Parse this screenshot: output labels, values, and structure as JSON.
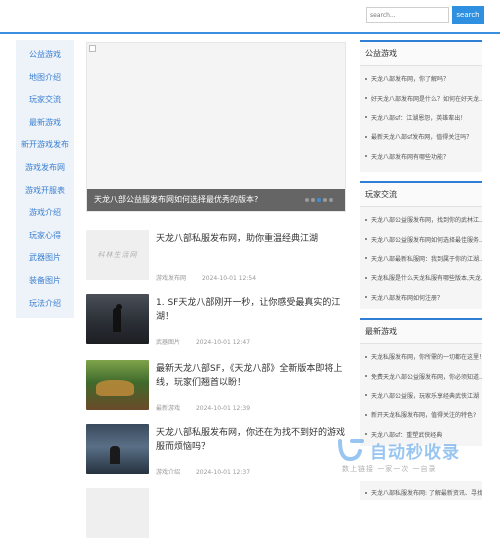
{
  "header": {
    "search_placeholder": "search...",
    "search_button": "search",
    "accent_color": "#3b8fe0"
  },
  "sidebar": {
    "items": [
      {
        "label": "公益游戏"
      },
      {
        "label": "地图介绍"
      },
      {
        "label": "玩家交流"
      },
      {
        "label": "最新游戏"
      },
      {
        "label": "新开游戏发布"
      },
      {
        "label": "游戏发布网"
      },
      {
        "label": "游戏开服表"
      },
      {
        "label": "游戏介绍"
      },
      {
        "label": "玩家心得"
      },
      {
        "label": "武器图片"
      },
      {
        "label": "装备图片"
      },
      {
        "label": "玩法介绍"
      }
    ]
  },
  "banner": {
    "caption": "天龙八部公益服发布网如何选择最优秀的版本?",
    "slides": 5,
    "active_slide": 3
  },
  "articles": [
    {
      "title": "天龙八部私服发布网，助你重温经典江湖",
      "category": "游戏发布网",
      "date": "2024-10-01 12:54",
      "thumb_icon": "watermark-thumbnail",
      "thumb_text": "科林生活网"
    },
    {
      "title": "1. SF天龙八部刚开一秒，让你感受最真实的江湖！",
      "category": "武器图片",
      "date": "2024-10-01 12:47",
      "thumb_icon": "dark-figure-thumbnail"
    },
    {
      "title": "最新天龙八部SF，《天龙八部》全新版本即将上线，玩家们翘首以盼！",
      "category": "最新游戏",
      "date": "2024-10-01 12:39",
      "thumb_icon": "forest-thumbnail"
    },
    {
      "title": "天龙八部私服发布网，你还在为找不到好的游戏服而烦恼吗？",
      "category": "游戏介绍",
      "date": "2024-10-01 12:37",
      "thumb_icon": "sky-figure-thumbnail"
    }
  ],
  "panels": [
    {
      "title": "公益游戏",
      "items": [
        "天龙八部发布网，你了解吗？",
        "好天龙八部发布网是什么？如何在好天龙...",
        "天龙八部sf：江湖恩怨，英雄辈出！",
        "最新天龙八部sf发布网，值得关注吗？",
        "天龙八部发布网有哪些功能？"
      ]
    },
    {
      "title": "玩家交流",
      "items": [
        "天龙八部公益服发布网，找到你的武林江...",
        "天龙八部公益服发布网如何选择最佳服务...",
        "天龙八部最新私服网：我到属于你的江湖...",
        "天龙私服是什么天龙私服有哪些版本,天龙...",
        "天龙八部发布网如何注册？"
      ]
    },
    {
      "title": "最新游戏",
      "items": [
        "天龙私服发布网，你所需的一切都在这里！",
        "免费天龙八部公益服发布网，你必须知道...",
        "天龙八部公益服，玩家乐享经典武侠江湖",
        "新开天龙私服发布网，值得关注的特色?",
        "天龙八部sf：重塑武侠经典"
      ]
    },
    {
      "title": "",
      "items": [
        "天龙八部私服发布网: 了解最新资讯、寻找..."
      ]
    }
  ],
  "watermark": {
    "brand": "自动秒收录",
    "tagline": "数上链接 一家一次 一自录",
    "color": "#4696e6"
  }
}
